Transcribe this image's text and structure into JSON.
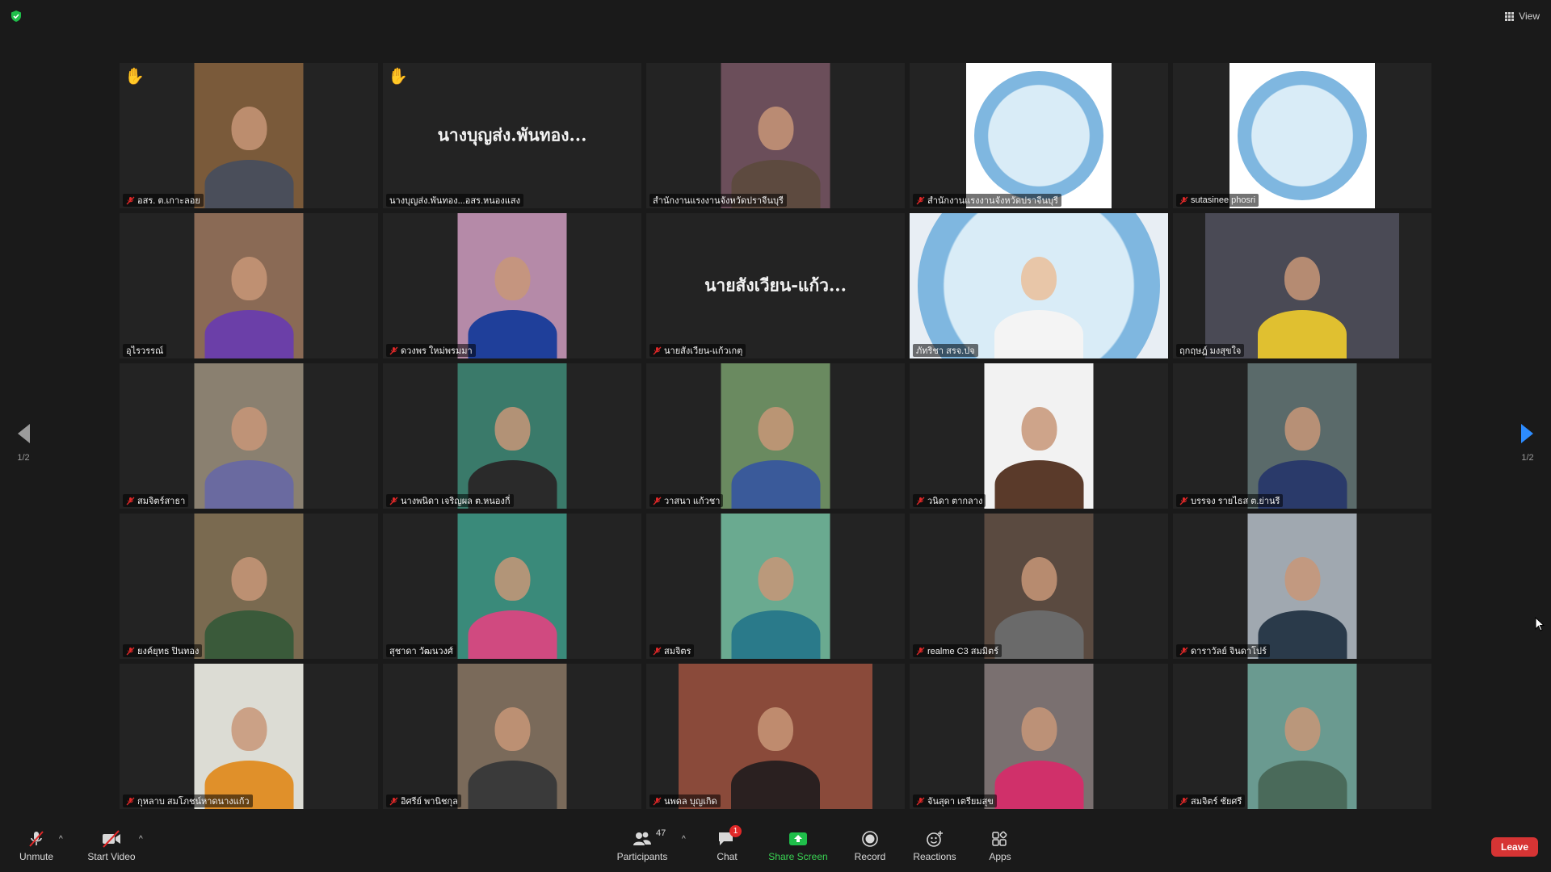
{
  "colors": {
    "background": "#1a1a1a",
    "tile": "#232323",
    "active_border": "#e8d445",
    "share_green": "#1fbf4a",
    "leave_red": "#d63434",
    "nav_arrow_blue": "#2d8cff"
  },
  "topbar": {
    "security_icon": "green-shield-icon",
    "view_label": "View"
  },
  "pagination": {
    "left_page": "1/2",
    "right_page": "1/2"
  },
  "tiles": [
    {
      "label": "อสร. ต.เกาะลอย",
      "muted": true,
      "hand": true,
      "kind": "video",
      "bg": "#7a5a3a",
      "body": "#4a4e5a"
    },
    {
      "label": "นางบุญส่ง.พันทอง...อสร.หนองแสง",
      "muted": false,
      "hand": true,
      "kind": "text",
      "name_text": "นางบุญส่ง.พันทอง..."
    },
    {
      "label": "สำนักงานแรงงานจังหวัดปราจีนบุรี",
      "muted": false,
      "hand": false,
      "kind": "video",
      "bg": "#6b4e5a",
      "body": "#5d4a3f"
    },
    {
      "label": "สำนักงานแรงงานจังหวัดปราจีนบุรี",
      "muted": true,
      "hand": false,
      "kind": "seal"
    },
    {
      "label": "sutasinee phosri",
      "muted": true,
      "hand": false,
      "kind": "seal"
    },
    {
      "label": "อุไรวรรณ์",
      "muted": false,
      "hand": false,
      "kind": "video",
      "bg": "#8a6a55",
      "body": "#6b3fa8"
    },
    {
      "label": "ดวงพร ใหม่พรมมา",
      "muted": true,
      "hand": false,
      "kind": "video",
      "bg": "#b58aa8",
      "body": "#1f3f9a"
    },
    {
      "label": "นายสังเวียน-แก้วเกตุ",
      "muted": true,
      "hand": false,
      "kind": "text",
      "name_text": "นายสังเวียน-แก้ว..."
    },
    {
      "label": "ภัทริชา สรจ.ปจ",
      "muted": false,
      "hand": false,
      "kind": "seal_person",
      "active": true
    },
    {
      "label": "ฤกฤษฎ์ มงสุขใจ",
      "muted": false,
      "hand": false,
      "kind": "video",
      "bg": "#4a4a55",
      "body": "#e0c030",
      "wide": true
    },
    {
      "label": "สมจิตร์สาธา",
      "muted": true,
      "hand": false,
      "kind": "video",
      "bg": "#8a8070",
      "body": "#6a6aa0"
    },
    {
      "label": "นางพนิดา เจริญผล ต.หนองกี่",
      "muted": true,
      "hand": false,
      "kind": "video",
      "bg": "#3a7a6a",
      "body": "#2a2a2a"
    },
    {
      "label": "วาสนา แก้วชา",
      "muted": true,
      "hand": false,
      "kind": "video",
      "bg": "#6a8a60",
      "body": "#3a5a9a"
    },
    {
      "label": "วนิดา ตากลาง",
      "muted": true,
      "hand": false,
      "kind": "video",
      "bg": "#f2f2f2",
      "body": "#5a3a2a"
    },
    {
      "label": "บรรจง รายไธส ต.ย่านรี",
      "muted": true,
      "hand": false,
      "kind": "video",
      "bg": "#5a6a6a",
      "body": "#2a3a6a"
    },
    {
      "label": "ยงค์ยุทธ ปินทอง",
      "muted": true,
      "hand": false,
      "kind": "video",
      "bg": "#7a6a50",
      "body": "#3a5a3a"
    },
    {
      "label": "สุชาดา วัฒนวงศ์",
      "muted": false,
      "hand": false,
      "kind": "video",
      "bg": "#3a8a7a",
      "body": "#d04a80"
    },
    {
      "label": "สมจิตร",
      "muted": true,
      "hand": false,
      "kind": "video",
      "bg": "#6aaa90",
      "body": "#2a7a8a"
    },
    {
      "label": "realme C3 สมมิตร์",
      "muted": true,
      "hand": false,
      "kind": "video",
      "bg": "#5a4a40",
      "body": "#6a6a6a"
    },
    {
      "label": "ดาราวัลย์ จินดาโปร์",
      "muted": true,
      "hand": false,
      "kind": "video",
      "bg": "#a0a8b0",
      "body": "#2a3a4a"
    },
    {
      "label": "กุหลาบ สมโภชน์หาดนางแก้ว",
      "muted": true,
      "hand": false,
      "kind": "video",
      "bg": "#dcdcd4",
      "body": "#e0902a"
    },
    {
      "label": "อิศรีย์ พานิชกุล",
      "muted": true,
      "hand": false,
      "kind": "video",
      "bg": "#7a6a5a",
      "body": "#3a3a3a"
    },
    {
      "label": "นพดล บุญเกิด",
      "muted": true,
      "hand": false,
      "kind": "video",
      "bg": "#8a4a3a",
      "body": "#2a2020",
      "wide": true
    },
    {
      "label": "จันสุดา เตรียมสุข",
      "muted": true,
      "hand": false,
      "kind": "video",
      "bg": "#7a7070",
      "body": "#d0306a"
    },
    {
      "label": "สมจิตร์ ชัยศรี",
      "muted": true,
      "hand": false,
      "kind": "video",
      "bg": "#6a9a90",
      "body": "#4a6a5a"
    }
  ],
  "toolbar": {
    "unmute": "Unmute",
    "start_video": "Start Video",
    "participants": "Participants",
    "participants_count": "47",
    "chat": "Chat",
    "chat_badge": "1",
    "share_screen": "Share Screen",
    "record": "Record",
    "reactions": "Reactions",
    "apps": "Apps",
    "leave": "Leave"
  }
}
